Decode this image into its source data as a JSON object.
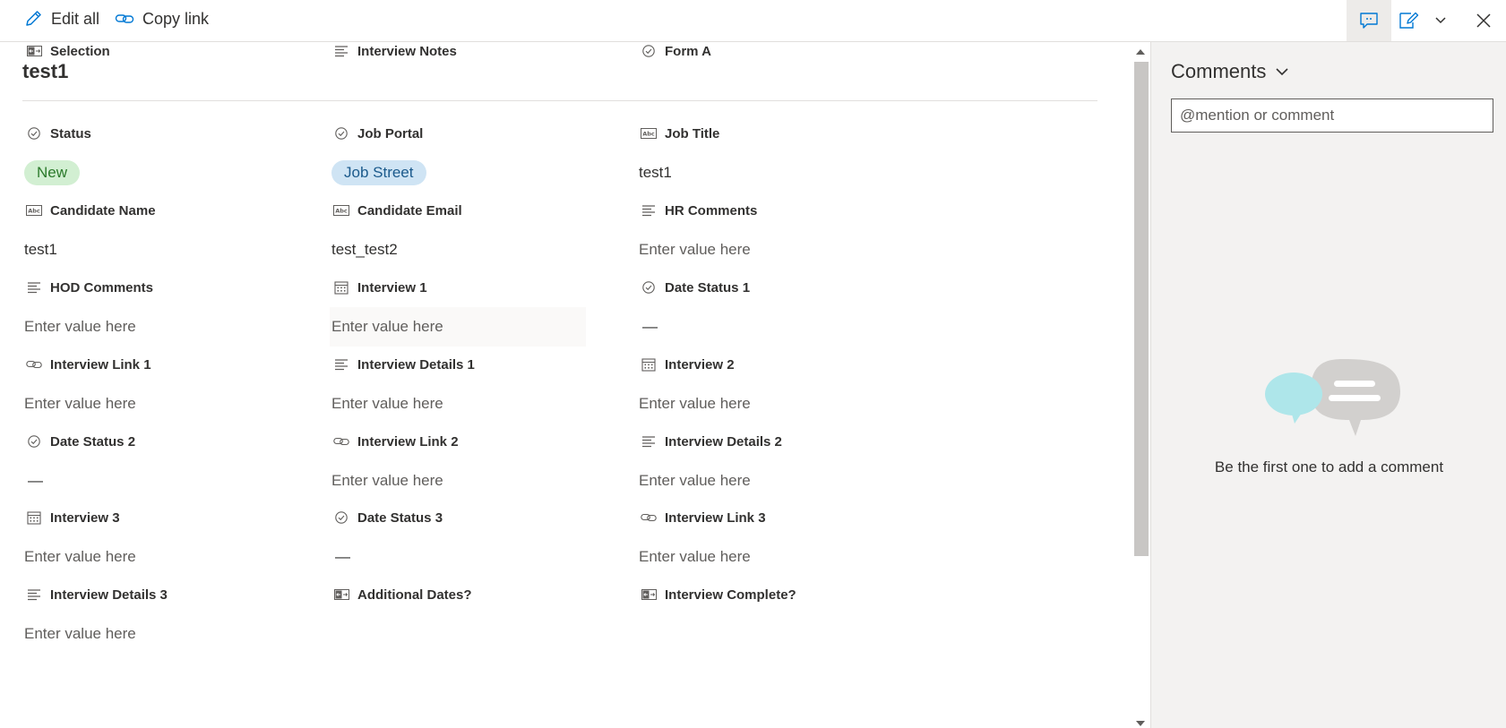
{
  "toolbar": {
    "edit_all": "Edit all",
    "copy_link": "Copy link"
  },
  "item": {
    "title": "test1"
  },
  "fields": [
    {
      "label": "Status",
      "icon": "choice-icon",
      "value": "New",
      "kind": "pill",
      "pill_color": "green"
    },
    {
      "label": "Job Portal",
      "icon": "choice-icon",
      "value": "Job Street",
      "kind": "pill",
      "pill_color": "blue"
    },
    {
      "label": "Job Title",
      "icon": "text-icon",
      "value": "test1",
      "kind": "text"
    },
    {
      "label": "Candidate Name",
      "icon": "text-icon",
      "value": "test1",
      "kind": "text"
    },
    {
      "label": "Candidate Email",
      "icon": "text-icon",
      "value": "test_test2",
      "kind": "text"
    },
    {
      "label": "HR Comments",
      "icon": "multiline-icon",
      "value": "Enter value here",
      "kind": "placeholder"
    },
    {
      "label": "HOD Comments",
      "icon": "multiline-icon",
      "value": "Enter value here",
      "kind": "placeholder"
    },
    {
      "label": "Interview 1",
      "icon": "calendar-icon",
      "value": "Enter value here",
      "kind": "placeholder"
    },
    {
      "label": "Date Status 1",
      "icon": "choice-icon",
      "value": "—",
      "kind": "dash"
    },
    {
      "label": "Interview Link 1",
      "icon": "link-icon",
      "value": "Enter value here",
      "kind": "placeholder"
    },
    {
      "label": "Interview Details 1",
      "icon": "multiline-icon",
      "value": "Enter value here",
      "kind": "placeholder"
    },
    {
      "label": "Interview 2",
      "icon": "calendar-icon",
      "value": "Enter value here",
      "kind": "placeholder"
    },
    {
      "label": "Date Status 2",
      "icon": "choice-icon",
      "value": "—",
      "kind": "dash"
    },
    {
      "label": "Interview Link 2",
      "icon": "link-icon",
      "value": "Enter value here",
      "kind": "placeholder"
    },
    {
      "label": "Interview Details 2",
      "icon": "multiline-icon",
      "value": "Enter value here",
      "kind": "placeholder"
    },
    {
      "label": "Interview 3",
      "icon": "calendar-icon",
      "value": "Enter value here",
      "kind": "placeholder"
    },
    {
      "label": "Date Status 3",
      "icon": "choice-icon",
      "value": "—",
      "kind": "dash"
    },
    {
      "label": "Interview Link 3",
      "icon": "link-icon",
      "value": "Enter value here",
      "kind": "placeholder"
    },
    {
      "label": "Interview Details 3",
      "icon": "multiline-icon",
      "value": "Enter value here",
      "kind": "placeholder"
    },
    {
      "label": "Additional Dates?",
      "icon": "yesno-icon",
      "value": "",
      "kind": "empty"
    },
    {
      "label": "Interview Complete?",
      "icon": "yesno-icon",
      "value": "",
      "kind": "empty"
    },
    {
      "label": "Selection",
      "icon": "yesno-icon",
      "value": "",
      "kind": "empty"
    },
    {
      "label": "Interview Notes",
      "icon": "multiline-icon",
      "value": "",
      "kind": "empty"
    },
    {
      "label": "Form A",
      "icon": "choice-icon",
      "value": "",
      "kind": "empty"
    }
  ],
  "comments": {
    "title": "Comments",
    "placeholder": "@mention or comment",
    "empty_message": "Be the first one to add a comment"
  },
  "colors": {
    "pill_green_bg": "#d2efd2",
    "pill_blue_bg": "#cfe4f4",
    "accent": "#0078d4"
  }
}
